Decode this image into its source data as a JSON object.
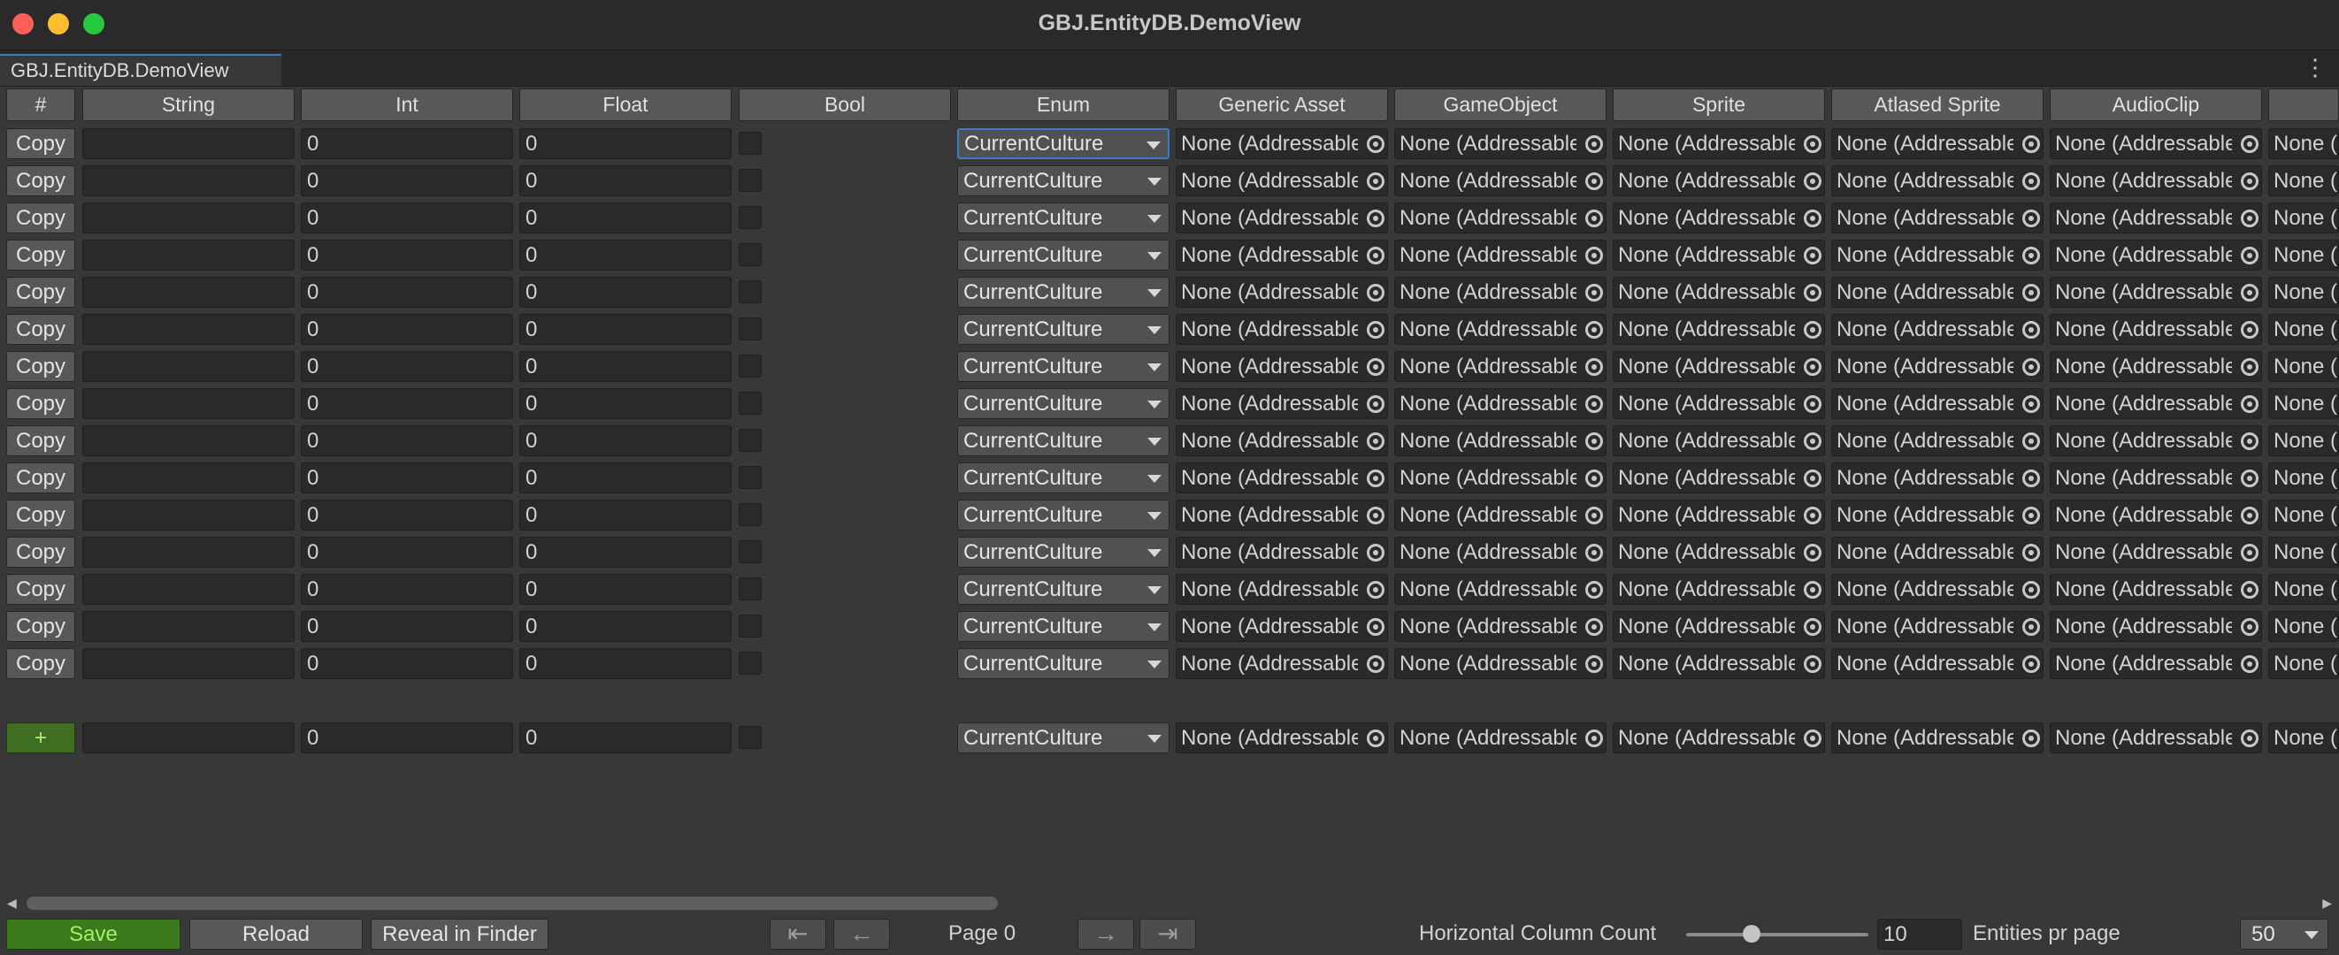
{
  "window": {
    "title": "GBJ.EntityDB.DemoView"
  },
  "tab": {
    "label": "GBJ.EntityDB.DemoView"
  },
  "columns": [
    "#",
    "String",
    "Int",
    "Float",
    "Bool",
    "Enum",
    "Generic Asset",
    "GameObject",
    "Sprite",
    "Atlased Sprite",
    "AudioClip"
  ],
  "rows": {
    "count": 15,
    "copy_label": "Copy",
    "string_value": "",
    "int_value": "0",
    "float_value": "0",
    "enum_value": "CurrentCulture",
    "asset_value": "None (Addressable",
    "cut_value": "None ("
  },
  "new_row": {
    "add_label": "+",
    "string_value": "",
    "int_value": "0",
    "float_value": "0",
    "enum_value": "CurrentCulture",
    "asset_value": "None (Addressable",
    "cut_value": "None ("
  },
  "footer": {
    "save_label": "Save",
    "reload_label": "Reload",
    "reveal_label": "Reveal in Finder",
    "first_page_glyph": "⇤",
    "prev_page_glyph": "←",
    "page_label": "Page 0",
    "next_page_glyph": "→",
    "last_page_glyph": "⇥",
    "column_count_label": "Horizontal Column Count",
    "column_count_value": "10",
    "column_count_slider_fraction": 0.31,
    "entities_label": "Entities pr page",
    "entities_value": "50"
  },
  "colors": {
    "background": "#383838",
    "header": "#585858",
    "field": "#2a2a2a",
    "accent": "#3a79bb",
    "save_green": "#3d7a1e"
  },
  "icons": [
    "close-icon",
    "minimize-icon",
    "zoom-icon",
    "kebab-menu-icon",
    "object-picker-icon",
    "dropdown-caret-icon",
    "scroll-left-icon",
    "scroll-right-icon"
  ]
}
